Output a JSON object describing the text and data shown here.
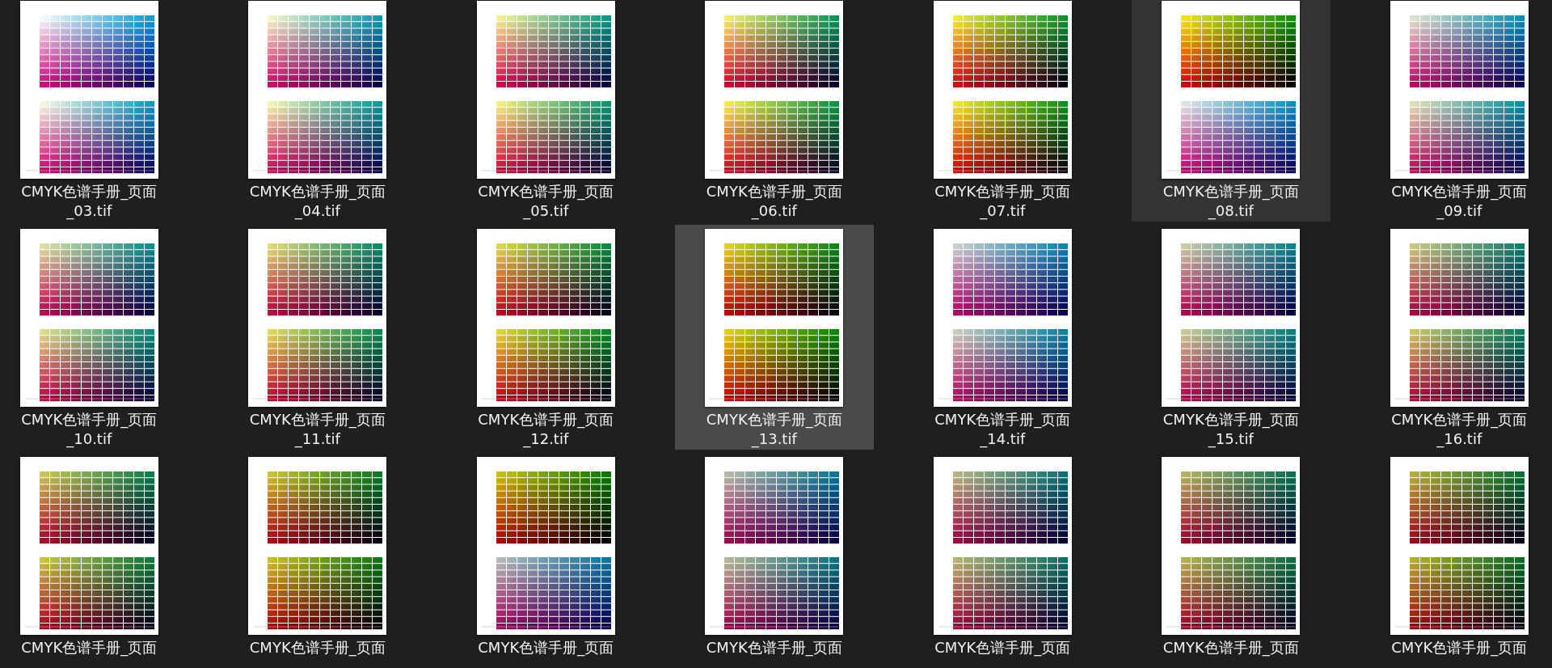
{
  "files": [
    {
      "name": "CMYK色谱手册_页面_03.tif",
      "selected": false,
      "hovered": false
    },
    {
      "name": "CMYK色谱手册_页面_04.tif",
      "selected": false,
      "hovered": false
    },
    {
      "name": "CMYK色谱手册_页面_05.tif",
      "selected": false,
      "hovered": false
    },
    {
      "name": "CMYK色谱手册_页面_06.tif",
      "selected": false,
      "hovered": false
    },
    {
      "name": "CMYK色谱手册_页面_07.tif",
      "selected": false,
      "hovered": false
    },
    {
      "name": "CMYK色谱手册_页面_08.tif",
      "selected": false,
      "hovered": true
    },
    {
      "name": "CMYK色谱手册_页面_09.tif",
      "selected": false,
      "hovered": false
    },
    {
      "name": "CMYK色谱手册_页面_10.tif",
      "selected": false,
      "hovered": false
    },
    {
      "name": "CMYK色谱手册_页面_11.tif",
      "selected": false,
      "hovered": false
    },
    {
      "name": "CMYK色谱手册_页面_12.tif",
      "selected": false,
      "hovered": false
    },
    {
      "name": "CMYK色谱手册_页面_13.tif",
      "selected": true,
      "hovered": false
    },
    {
      "name": "CMYK色谱手册_页面_14.tif",
      "selected": false,
      "hovered": false
    },
    {
      "name": "CMYK色谱手册_页面_15.tif",
      "selected": false,
      "hovered": false
    },
    {
      "name": "CMYK色谱手册_页面_16.tif",
      "selected": false,
      "hovered": false
    },
    {
      "name": "CMYK色谱手册_页面",
      "selected": false,
      "hovered": false
    },
    {
      "name": "CMYK色谱手册_页面",
      "selected": false,
      "hovered": false
    },
    {
      "name": "CMYK色谱手册_页面",
      "selected": false,
      "hovered": false
    },
    {
      "name": "CMYK色谱手册_页面",
      "selected": false,
      "hovered": false
    },
    {
      "name": "CMYK色谱手册_页面",
      "selected": false,
      "hovered": false
    },
    {
      "name": "CMYK色谱手册_页面",
      "selected": false,
      "hovered": false
    },
    {
      "name": "CMYK色谱手册_页面",
      "selected": false,
      "hovered": false
    }
  ]
}
